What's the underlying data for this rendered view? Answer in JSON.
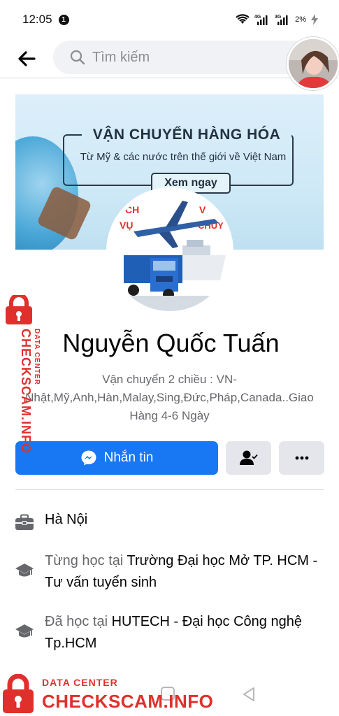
{
  "status_bar": {
    "time": "12:05",
    "notification_count": "1",
    "battery": "2%"
  },
  "search": {
    "placeholder": "Tìm kiếm"
  },
  "cover": {
    "title": "VẬN CHUYỂN HÀNG HÓA",
    "subtitle": "Từ Mỹ & các nước trên thế giới về Việt Nam",
    "button": "Xem ngay"
  },
  "profile": {
    "name": "Nguyễn Quốc Tuấn",
    "bio": "Vận chuyển 2 chiều : VN-Nhật,Mỹ,Anh,Hàn,Malay,Sing,Đức,Pháp,Canada..Giao Hàng 4-6 Ngày"
  },
  "actions": {
    "message_label": "Nhắn tin"
  },
  "details": {
    "location": "Hà Nội",
    "edu1_prefix": "Từng học tại ",
    "edu1_school": "Trường Đại học Mở TP. HCM - Tư vấn tuyển sinh",
    "edu2_prefix": "Đã học tại ",
    "edu2_school": "HUTECH - Đại học Công nghệ Tp.HCM"
  },
  "watermark": {
    "small": "DATA CENTER",
    "big": "CHECKSCAM.INFO"
  },
  "colors": {
    "accent": "#1877f2",
    "watermark": "#e0302c"
  }
}
